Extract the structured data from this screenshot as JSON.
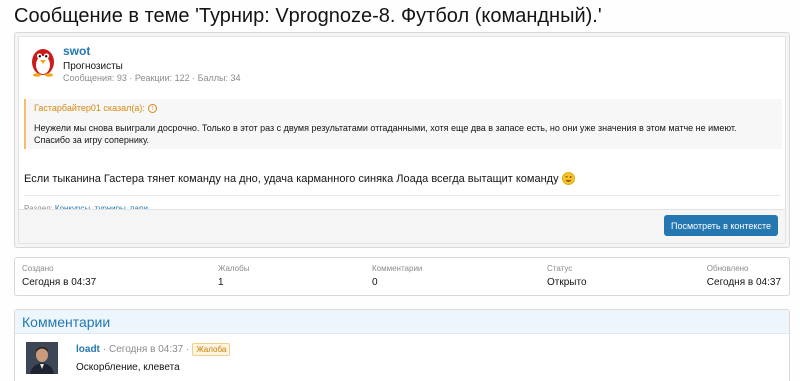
{
  "page_title": "Сообщение в теме 'Турнир: Vprognoze-8. Футбол (командный).'",
  "post": {
    "author": "swot",
    "user_title": "Прогнозисты",
    "user_stats": "Сообщения: 93 · Реакции: 122 · Баллы: 34",
    "quote_header": "Гастарбайтер01 сказал(а):",
    "quote_text": "Неужели мы снова выиграли досрочно. Только в этот раз с двумя результатами отгаданными, хотя еще два в запасе есть, но они уже значения в этом матче не имеют. Спасибо за игру сопернику.",
    "message": "Если тыканина Гастера тянет команду на дно, удача карманного синяка Лоада всегда вытащит команду",
    "section_label": "Раздел:",
    "section_link": "Конкурсы, турниры, пари",
    "context_button": "Посмотреть в контексте"
  },
  "stats": [
    {
      "label": "Создано",
      "value": "Сегодня в 04:37"
    },
    {
      "label": "Жалобы",
      "value": "1"
    },
    {
      "label": "Комментарии",
      "value": "0"
    },
    {
      "label": "Статус",
      "value": "Открыто"
    },
    {
      "label": "Обновлено",
      "value": "Сегодня в 04:37"
    }
  ],
  "comments": {
    "title": "Комментарии",
    "items": [
      {
        "author": "loadt",
        "time": "· Сегодня в 04:37 ·",
        "badge": "Жалоба",
        "text": "Оскорбление, клевета"
      }
    ]
  },
  "colors": {
    "accent": "#2577b1",
    "quote_border": "#f9bc6d",
    "quote_text": "#d58913",
    "badge": "#c77d00"
  },
  "icons": [
    "penguin-avatar",
    "quote-arrow-icon",
    "wink-smiley-icon",
    "user-photo-avatar"
  ]
}
